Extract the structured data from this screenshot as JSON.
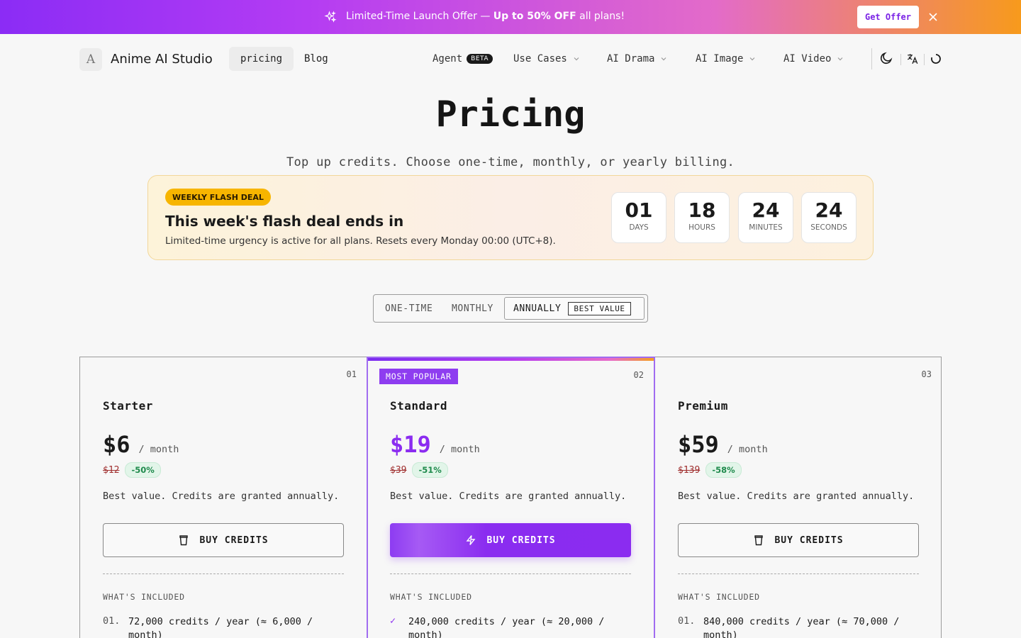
{
  "banner": {
    "prefix": "Limited-Time Launch Offer —",
    "highlight": "Up to 50% OFF",
    "suffix": "all plans!",
    "cta": "Get Offer"
  },
  "nav": {
    "logo_letter": "A",
    "brand": "Anime AI Studio",
    "links": [
      "pricing",
      "Blog"
    ],
    "agent": "Agent",
    "beta": "BETA",
    "menus": [
      "Use Cases",
      "AI Drama",
      "AI Image",
      "AI Video"
    ]
  },
  "hero": {
    "title": "Pricing",
    "subtitle": "Top up credits. Choose one-time, monthly, or yearly billing."
  },
  "deal": {
    "badge": "WEEKLY FLASH DEAL",
    "title": "This week's flash deal ends in",
    "desc": "Limited-time urgency is active for all plans. Resets every Monday 00:00 (UTC+8).",
    "countdown": [
      {
        "value": "01",
        "label": "DAYS"
      },
      {
        "value": "18",
        "label": "HOURS"
      },
      {
        "value": "24",
        "label": "MINUTES"
      },
      {
        "value": "24",
        "label": "SECONDS"
      }
    ]
  },
  "billing": {
    "options": [
      "ONE-TIME",
      "MONTHLY",
      "ANNUALLY"
    ],
    "selected": "ANNUALLY",
    "best_value": "BEST VALUE"
  },
  "plans": [
    {
      "num": "01",
      "name": "Starter",
      "price": "$6",
      "per": "/ month",
      "old": "$12",
      "discount": "-50%",
      "desc": "Best value. Credits are granted annually.",
      "cta": "BUY CREDITS",
      "included": "WHAT'S INCLUDED",
      "feature_idx": "01.",
      "feature": "72,000 credits / year (≈ 6,000 / month)"
    },
    {
      "num": "02",
      "name": "Standard",
      "price": "$19",
      "per": "/ month",
      "old": "$39",
      "discount": "-51%",
      "badge": "MOST POPULAR",
      "desc": "Best value. Credits are granted annually.",
      "cta": "BUY CREDITS",
      "included": "WHAT'S INCLUDED",
      "feature_idx": "✓",
      "feature": "240,000 credits / year (≈ 20,000 / month)"
    },
    {
      "num": "03",
      "name": "Premium",
      "price": "$59",
      "per": "/ month",
      "old": "$139",
      "discount": "-58%",
      "desc": "Best value. Credits are granted annually.",
      "cta": "BUY CREDITS",
      "included": "WHAT'S INCLUDED",
      "feature_idx": "01.",
      "feature": "840,000 credits / year (≈ 70,000 / month)"
    }
  ]
}
